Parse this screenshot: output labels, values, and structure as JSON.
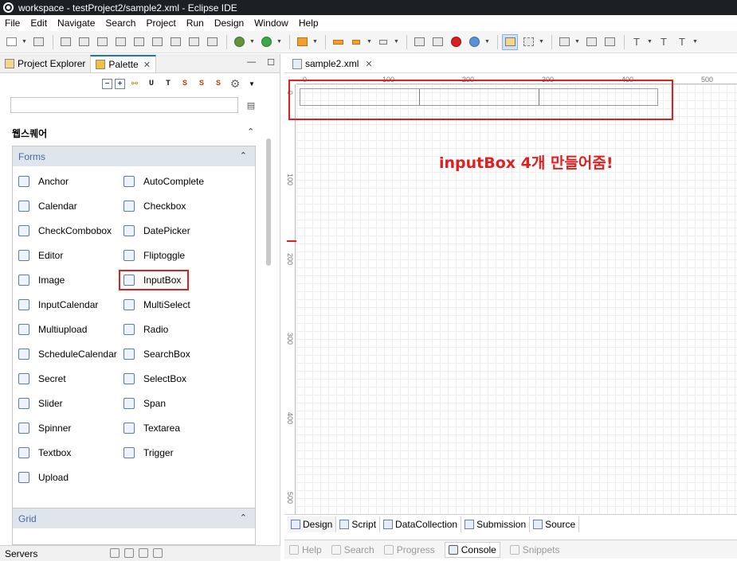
{
  "window": {
    "title": "workspace - testProject2/sample2.xml - Eclipse IDE"
  },
  "menu": [
    "File",
    "Edit",
    "Navigate",
    "Search",
    "Project",
    "Run",
    "Design",
    "Window",
    "Help"
  ],
  "left_panel": {
    "tabs": [
      {
        "label": "Project Explorer",
        "active": false
      },
      {
        "label": "Palette",
        "active": true
      }
    ],
    "palette_tools": [
      "U",
      "T",
      "S",
      "S",
      "S"
    ],
    "search_placeholder": "",
    "drawer_title": "웹스퀘어",
    "forms_group": {
      "title": "Forms",
      "items_left": [
        "Anchor",
        "Calendar",
        "CheckCombobox",
        "Editor",
        "Image",
        "InputCalendar",
        "Multiupload",
        "ScheduleCalendar",
        "Secret",
        "Slider",
        "Spinner",
        "Textbox",
        "Upload"
      ],
      "items_right": [
        "AutoComplete",
        "Checkbox",
        "DatePicker",
        "Fliptoggle",
        "InputBox",
        "MultiSelect",
        "Radio",
        "SearchBox",
        "SelectBox",
        "Span",
        "Textarea",
        "Trigger"
      ],
      "highlighted_item": "InputBox"
    },
    "grid_group": {
      "title": "Grid"
    }
  },
  "bottom_left": {
    "tab": "Servers"
  },
  "editor": {
    "tab": "sample2.xml",
    "ruler_h_labels": [
      "0",
      "100",
      "200",
      "300",
      "400",
      "500"
    ],
    "ruler_v_labels": [
      "0",
      "100",
      "200",
      "300",
      "400",
      "500"
    ],
    "annotation": "inputBox 4개 만들어줌!",
    "bottom_tabs": [
      "Design",
      "Script",
      "DataCollection",
      "Submission",
      "Source"
    ]
  },
  "console_bar": {
    "tabs": [
      {
        "label": "Help",
        "active": false
      },
      {
        "label": "Search",
        "active": false
      },
      {
        "label": "Progress",
        "active": false
      },
      {
        "label": "Console",
        "active": true
      },
      {
        "label": "Snippets",
        "active": false
      }
    ]
  },
  "colors": {
    "titlebar": "#1c1f24",
    "highlight": "#e02020",
    "tab_accent": "#1e70c8",
    "group_header_text": "#4a6a9a"
  }
}
